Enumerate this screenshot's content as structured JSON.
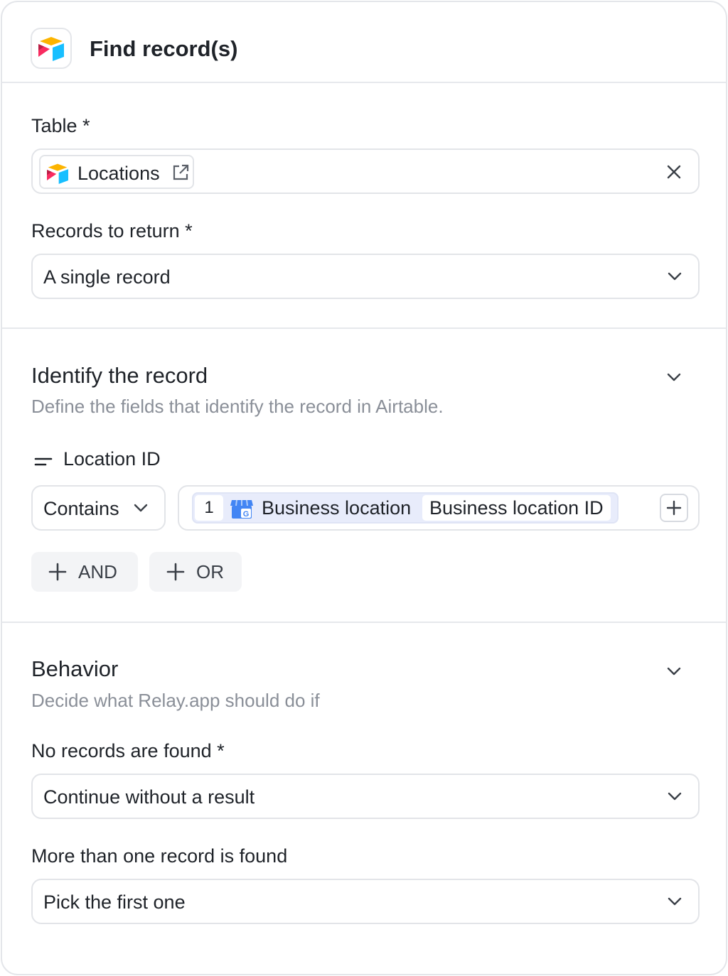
{
  "header": {
    "title": "Find record(s)",
    "app_icon": "airtable-logo"
  },
  "table": {
    "label": "Table *",
    "chip_label": "Locations",
    "chip_icon": "airtable-logo",
    "external_icon": "external-link-icon",
    "clear_icon": "close-icon"
  },
  "records_to_return": {
    "label": "Records to return *",
    "value": "A single record"
  },
  "identify": {
    "title": "Identify the record",
    "subtitle": "Define the fields that identify the record in Airtable.",
    "condition": {
      "field_label": "Location ID",
      "operator": "Contains",
      "token": {
        "step": "1",
        "source": "Business location",
        "field": "Business location ID"
      }
    },
    "and_label": "AND",
    "or_label": "OR"
  },
  "behavior": {
    "title": "Behavior",
    "subtitle": "Decide what Relay.app should do if",
    "no_records": {
      "label": "No records are found *",
      "value": "Continue without a result"
    },
    "multiple": {
      "label": "More than one record is found",
      "value": "Pick the first one"
    }
  },
  "colors": {
    "border": "#e2e4e8",
    "token_bg": "#e8ecfb",
    "muted_text": "#8a8f98",
    "button_bg": "#f3f4f6"
  }
}
